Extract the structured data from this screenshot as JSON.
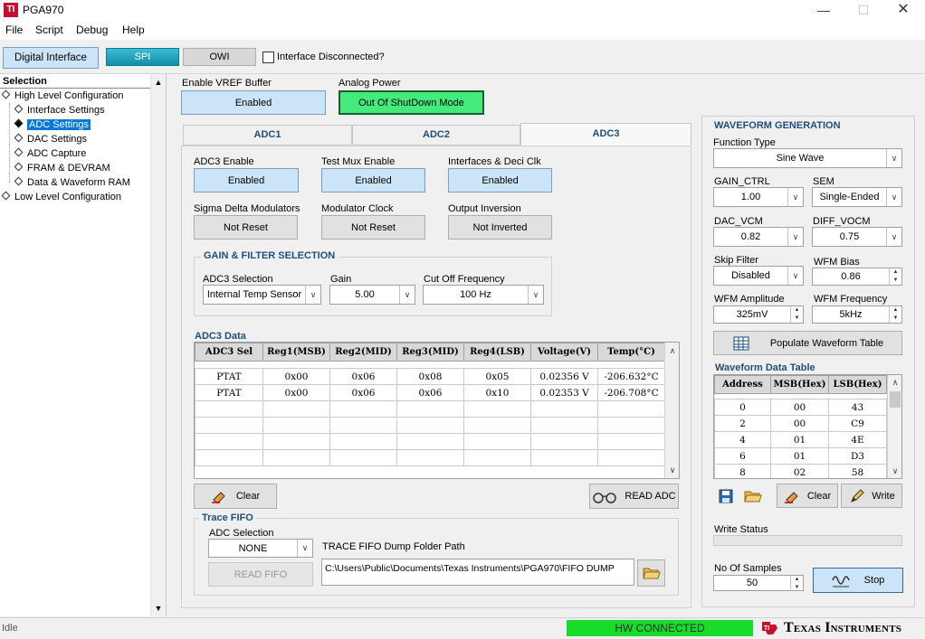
{
  "window": {
    "title": "PGA970",
    "icon_text": "TI"
  },
  "menu": [
    "File",
    "Script",
    "Debug",
    "Help"
  ],
  "toolbar": {
    "digital_interface": "Digital Interface",
    "spi": "SPI",
    "owi": "OWI",
    "interface_disconnected": "Interface Disconnected?"
  },
  "tree": {
    "header": "Selection",
    "items": [
      {
        "label": "High Level Configuration",
        "level": 0
      },
      {
        "label": "Interface Settings",
        "level": 1
      },
      {
        "label": "ADC Settings",
        "level": 1,
        "selected": true
      },
      {
        "label": "DAC Settings",
        "level": 1
      },
      {
        "label": "ADC Capture",
        "level": 1
      },
      {
        "label": "FRAM & DEVRAM",
        "level": 1
      },
      {
        "label": "Data & Waveform RAM",
        "level": 1
      },
      {
        "label": "Low Level Configuration",
        "level": 0
      }
    ]
  },
  "top": {
    "vref_label": "Enable VREF Buffer",
    "vref_value": "Enabled",
    "analog_power_label": "Analog Power",
    "analog_power_value": "Out Of ShutDown Mode"
  },
  "tabs": [
    "ADC1",
    "ADC2",
    "ADC3"
  ],
  "adc3": {
    "enable_label": "ADC3 Enable",
    "enable_value": "Enabled",
    "testmux_label": "Test Mux Enable",
    "testmux_value": "Enabled",
    "interfaces_label": "Interfaces & Deci Clk",
    "interfaces_value": "Enabled",
    "sdm_label": "Sigma Delta Modulators",
    "sdm_value": "Not Reset",
    "modclk_label": "Modulator Clock",
    "modclk_value": "Not Reset",
    "outinv_label": "Output Inversion",
    "outinv_value": "Not Inverted"
  },
  "gain_filter": {
    "title": "GAIN & FILTER SELECTION",
    "sel_label": "ADC3 Selection",
    "sel_value": "Internal Temp Sensor",
    "gain_label": "Gain",
    "gain_value": "5.00",
    "cutoff_label": "Cut Off Frequency",
    "cutoff_value": "100 Hz"
  },
  "adc3_data": {
    "title": "ADC3 Data",
    "columns": [
      "ADC3 Sel",
      "Reg1(MSB)",
      "Reg2(MID)",
      "Reg3(MID)",
      "Reg4(LSB)",
      "Voltage(V)",
      "Temp(°C)"
    ],
    "rows": [
      [
        "PTAT",
        "0x00",
        "0x06",
        "0x08",
        "0x05",
        "0.02356 V",
        "-206.632°C"
      ],
      [
        "PTAT",
        "0x00",
        "0x06",
        "0x06",
        "0x10",
        "0.02353 V",
        "-206.708°C"
      ],
      [
        "",
        "",
        "",
        "",
        "",
        "",
        ""
      ],
      [
        "",
        "",
        "",
        "",
        "",
        "",
        ""
      ],
      [
        "",
        "",
        "",
        "",
        "",
        "",
        ""
      ],
      [
        "",
        "",
        "",
        "",
        "",
        "",
        ""
      ]
    ],
    "clear_label": "Clear",
    "read_label": "READ ADC"
  },
  "trace_fifo": {
    "title": "Trace FIFO",
    "adc_sel_label": "ADC Selection",
    "adc_sel_value": "NONE",
    "read_label": "READ FIFO",
    "path_label": "TRACE FIFO Dump Folder Path",
    "path_value": "C:\\Users\\Public\\Documents\\Texas Instruments\\PGA970\\FIFO DUMP"
  },
  "waveform": {
    "title": "WAVEFORM GENERATION",
    "function_label": "Function Type",
    "function_value": "Sine Wave",
    "gain_ctrl_label": "GAIN_CTRL",
    "gain_ctrl_value": "1.00",
    "sem_label": "SEM",
    "sem_value": "Single-Ended",
    "dac_vcm_label": "DAC_VCM",
    "dac_vcm_value": "0.82",
    "diff_vocm_label": "DIFF_VOCM",
    "diff_vocm_value": "0.75",
    "skip_label": "Skip Filter",
    "skip_value": "Disabled",
    "bias_label": "WFM Bias",
    "bias_value": "0.86",
    "amp_label": "WFM Amplitude",
    "amp_value": "325mV",
    "freq_label": "WFM Frequency",
    "freq_value": "5kHz",
    "populate_label": "Populate Waveform Table",
    "table_title": "Waveform Data Table",
    "columns": [
      "Address",
      "MSB(Hex)",
      "LSB(Hex)"
    ],
    "rows": [
      [
        "0",
        "00",
        "43"
      ],
      [
        "2",
        "00",
        "C9"
      ],
      [
        "4",
        "01",
        "4E"
      ],
      [
        "6",
        "01",
        "D3"
      ],
      [
        "8",
        "02",
        "58"
      ]
    ],
    "clear_label": "Clear",
    "write_label": "Write",
    "write_status_label": "Write Status",
    "samples_label": "No Of  Samples",
    "samples_value": "50",
    "stop_label": "Stop"
  },
  "status": {
    "left": "Idle",
    "hw": "HW CONNECTED",
    "logo": "Texas Instruments"
  }
}
